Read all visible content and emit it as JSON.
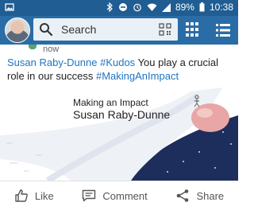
{
  "status_bar": {
    "battery": "89%",
    "time": "10:38"
  },
  "search": {
    "placeholder": "Search"
  },
  "post": {
    "time": "now",
    "author": "Susan Raby-Dunne",
    "hashtag_kudos": "#Kudos",
    "message": " You play a crucial role in our success ",
    "hashtag_impact": "#MakingAnImpact"
  },
  "card": {
    "title": "Making an Impact",
    "name": "Susan Raby-Dunne"
  },
  "actions": {
    "like": "Like",
    "comment": "Comment",
    "share": "Share"
  }
}
